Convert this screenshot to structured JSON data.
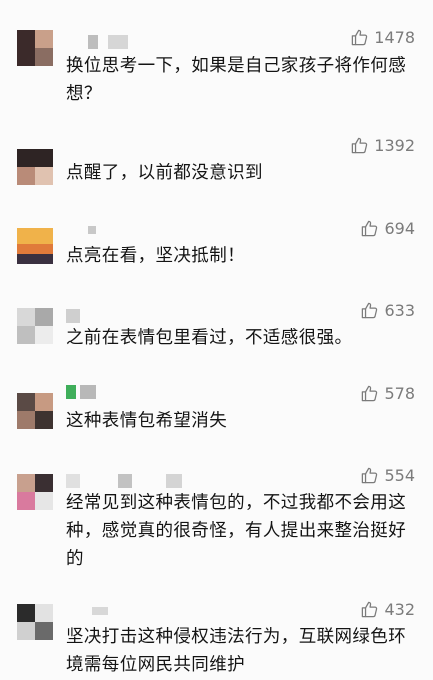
{
  "comments": [
    {
      "likes": "1478",
      "text": "换位思考一下，如果是自己家孩子将作何感想？"
    },
    {
      "likes": "1392",
      "text": "点醒了，以前都没意识到"
    },
    {
      "likes": "694",
      "text": "点亮在看，坚决抵制！"
    },
    {
      "likes": "633",
      "text": "之前在表情包里看过，不适感很强。"
    },
    {
      "likes": "578",
      "text": "这种表情包希望消失"
    },
    {
      "likes": "554",
      "text": "经常见到这种表情包的，不过我都不会用这种，感觉真的很奇怪，有人提出来整治挺好的"
    },
    {
      "likes": "432",
      "text": "坚决打击这种侵权违法行为，互联网绿色环境需每位网民共同维护"
    }
  ],
  "icons": {
    "like": "thumbs-up-icon"
  },
  "colors": {
    "like_count": "#7b7b7b",
    "text": "#141414",
    "background": "#fbfbfb"
  }
}
